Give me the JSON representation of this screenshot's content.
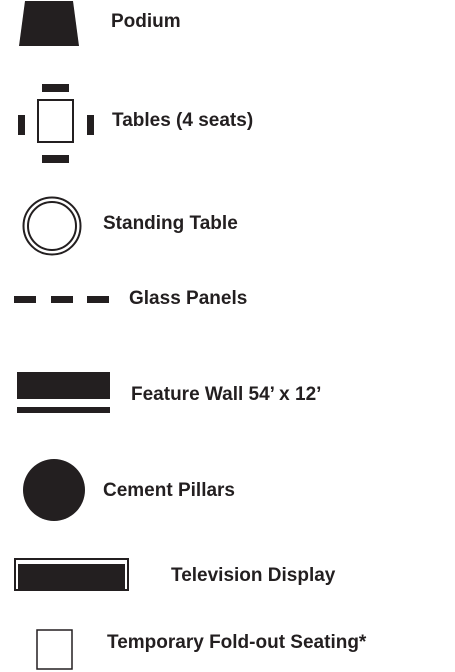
{
  "legend": {
    "items": [
      {
        "label": "Podium",
        "icon": "podium-icon"
      },
      {
        "label": "Tables (4 seats)",
        "icon": "table-four-seats-icon"
      },
      {
        "label": "Standing Table",
        "icon": "standing-table-icon"
      },
      {
        "label": "Glass Panels",
        "icon": "glass-panels-icon"
      },
      {
        "label": "Feature Wall 54’ x 12’",
        "icon": "feature-wall-icon"
      },
      {
        "label": "Cement Pillars",
        "icon": "cement-pillar-icon"
      },
      {
        "label": "Television Display",
        "icon": "television-display-icon"
      },
      {
        "label": "Temporary Fold-out Seating*",
        "icon": "fold-out-seating-icon"
      }
    ]
  },
  "colors": {
    "ink": "#231f20",
    "background": "#ffffff"
  }
}
